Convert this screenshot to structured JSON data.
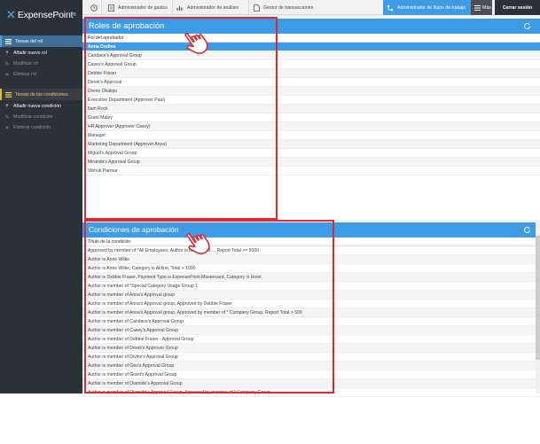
{
  "logo": {
    "name": "ExpensePoint"
  },
  "sidebar": {
    "sections": [
      {
        "title": "Tareas del rol",
        "items": [
          {
            "label": "Añadir nuevo rol",
            "icon": "plus-icon",
            "enabled": true
          },
          {
            "label": "Modificar rol",
            "icon": "pencil-icon",
            "enabled": false
          },
          {
            "label": "Eliminar rol",
            "icon": "close-icon",
            "enabled": false
          }
        ]
      },
      {
        "title": "Tareas de las condiciones",
        "items": [
          {
            "label": "Añadir nueva condición",
            "icon": "plus-icon",
            "enabled": true
          },
          {
            "label": "Modificar condición",
            "icon": "pencil-icon",
            "enabled": false
          },
          {
            "label": "Eliminar condición",
            "icon": "close-icon",
            "enabled": false
          }
        ]
      }
    ]
  },
  "topnav": {
    "items": [
      {
        "label": "",
        "icon": "clock-icon"
      },
      {
        "label": "Administrador de gastos",
        "icon": "receipt-icon"
      },
      {
        "label": "Administrador de análisis",
        "icon": "chart-icon"
      },
      {
        "label": "Gestor de transacciones",
        "icon": "document-icon"
      },
      {
        "label": "Administrador de flujos de trabajo",
        "icon": "workflow-icon",
        "active": true
      },
      {
        "label": "Más",
        "icon": "menu-icon"
      },
      {
        "label": "Cerrar sesión",
        "icon": ""
      }
    ]
  },
  "roles_panel": {
    "title": "Roles de aprobación",
    "column_header": "Rol del aprobador",
    "rows": [
      "Anna Dodina",
      "Candace's Approval Group",
      "Casey's Approval Group",
      "Debbie Fraser",
      "Derek's Approval",
      "Divine Okakpu",
      "Executive Department (Approver Paul)",
      "Ilam Rock",
      "Grant Maley",
      "HR Approver (Approver Casey)",
      "Manager",
      "Marketing Department (Approver Anna)",
      "Miguel's Approval Group",
      "Miranda's Approval Group",
      "Vibhuti Parmar"
    ],
    "selected_index": 0
  },
  "conditions_panel": {
    "title": "Condiciones de aprobación",
    "column_header": "Título de la condición",
    "rows": [
      "Approved by member of *All Employees, Author is member of ... Report Total >= 5000",
      "Author is Anne Wilke",
      "Author is Anne Wilke, Category is Airline, Total > 1000",
      "Author is Debbie Fraser, Payment Type is ExpensePoint Mastercard, Category is Hotel",
      "Author is member of *Special Category Usage Group 1",
      "Author is member of Anna's Approval group",
      "Author is member of Anna's Approval group, Approved by Debbie Fraser",
      "Author is member of Anna's Approval group, Approved by member of * Company Group, Report Total > 500",
      "Author is member of Candace's Approval Group",
      "Author is member of Casey's Approval Group",
      "Author is member of Debbie Fraser - Approval Group",
      "Author is member of Derek's Approver Group",
      "Author is member of Divine's Approval Group",
      "Author is member of Gen's Approval Group",
      "Author is member of Grant's Approval Group",
      "Author is member of Olamide's Approval Group",
      "Author is member of Olamide's Approval Group, Approved by member of * Company Group"
    ]
  },
  "colors": {
    "accent_blue": "#3e9be6",
    "sidebar_dark": "#2b3138",
    "highlight_red": "#e0282f"
  }
}
